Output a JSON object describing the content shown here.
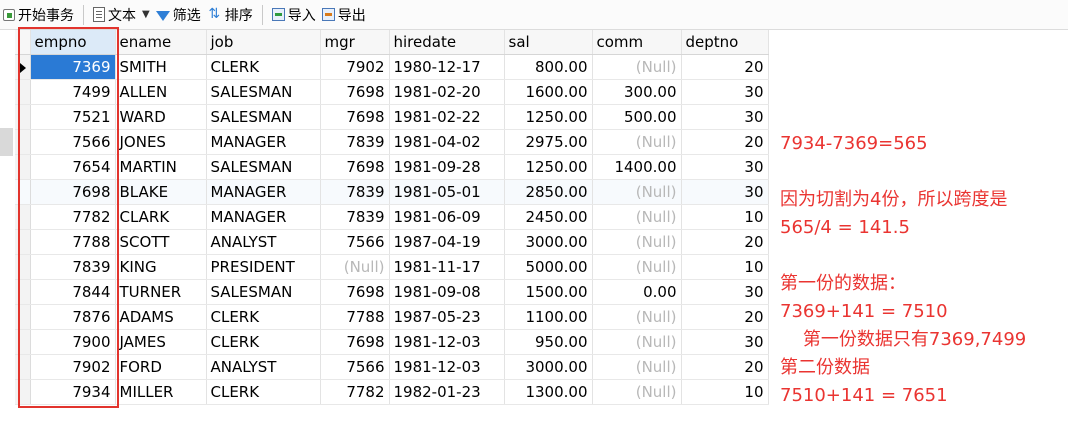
{
  "toolbar": {
    "begin_transaction": "开始事务",
    "text": "文本",
    "filter": "筛选",
    "sort": "排序",
    "import": "导入",
    "export": "导出"
  },
  "columns": [
    "empno",
    "ename",
    "job",
    "mgr",
    "hiredate",
    "sal",
    "comm",
    "deptno"
  ],
  "rows": [
    [
      "7369",
      "SMITH",
      "CLERK",
      "7902",
      "1980-12-17",
      "800.00",
      "(Null)",
      "20"
    ],
    [
      "7499",
      "ALLEN",
      "SALESMAN",
      "7698",
      "1981-02-20",
      "1600.00",
      "300.00",
      "30"
    ],
    [
      "7521",
      "WARD",
      "SALESMAN",
      "7698",
      "1981-02-22",
      "1250.00",
      "500.00",
      "30"
    ],
    [
      "7566",
      "JONES",
      "MANAGER",
      "7839",
      "1981-04-02",
      "2975.00",
      "(Null)",
      "20"
    ],
    [
      "7654",
      "MARTIN",
      "SALESMAN",
      "7698",
      "1981-09-28",
      "1250.00",
      "1400.00",
      "30"
    ],
    [
      "7698",
      "BLAKE",
      "MANAGER",
      "7839",
      "1981-05-01",
      "2850.00",
      "(Null)",
      "30"
    ],
    [
      "7782",
      "CLARK",
      "MANAGER",
      "7839",
      "1981-06-09",
      "2450.00",
      "(Null)",
      "10"
    ],
    [
      "7788",
      "SCOTT",
      "ANALYST",
      "7566",
      "1987-04-19",
      "3000.00",
      "(Null)",
      "20"
    ],
    [
      "7839",
      "KING",
      "PRESIDENT",
      "(Null)",
      "1981-11-17",
      "5000.00",
      "(Null)",
      "10"
    ],
    [
      "7844",
      "TURNER",
      "SALESMAN",
      "7698",
      "1981-09-08",
      "1500.00",
      "0.00",
      "30"
    ],
    [
      "7876",
      "ADAMS",
      "CLERK",
      "7788",
      "1987-05-23",
      "1100.00",
      "(Null)",
      "20"
    ],
    [
      "7900",
      "JAMES",
      "CLERK",
      "7698",
      "1981-12-03",
      "950.00",
      "(Null)",
      "30"
    ],
    [
      "7902",
      "FORD",
      "ANALYST",
      "7566",
      "1981-12-03",
      "3000.00",
      "(Null)",
      "20"
    ],
    [
      "7934",
      "MILLER",
      "CLERK",
      "7782",
      "1982-01-23",
      "1300.00",
      "(Null)",
      "10"
    ]
  ],
  "annotation": {
    "color": "#ea3431",
    "lines": [
      "7934-7369=565",
      "",
      "因为切割为4份，所以跨度是",
      "565/4 = 141.5",
      "",
      "第一份的数据：",
      "7369+141 = 7510",
      "    第一份数据只有7369,7499",
      "第二份数据",
      "7510+141 = 7651"
    ]
  },
  "highlight_color": "#e2342d",
  "selection_color": "#2a7ad5"
}
